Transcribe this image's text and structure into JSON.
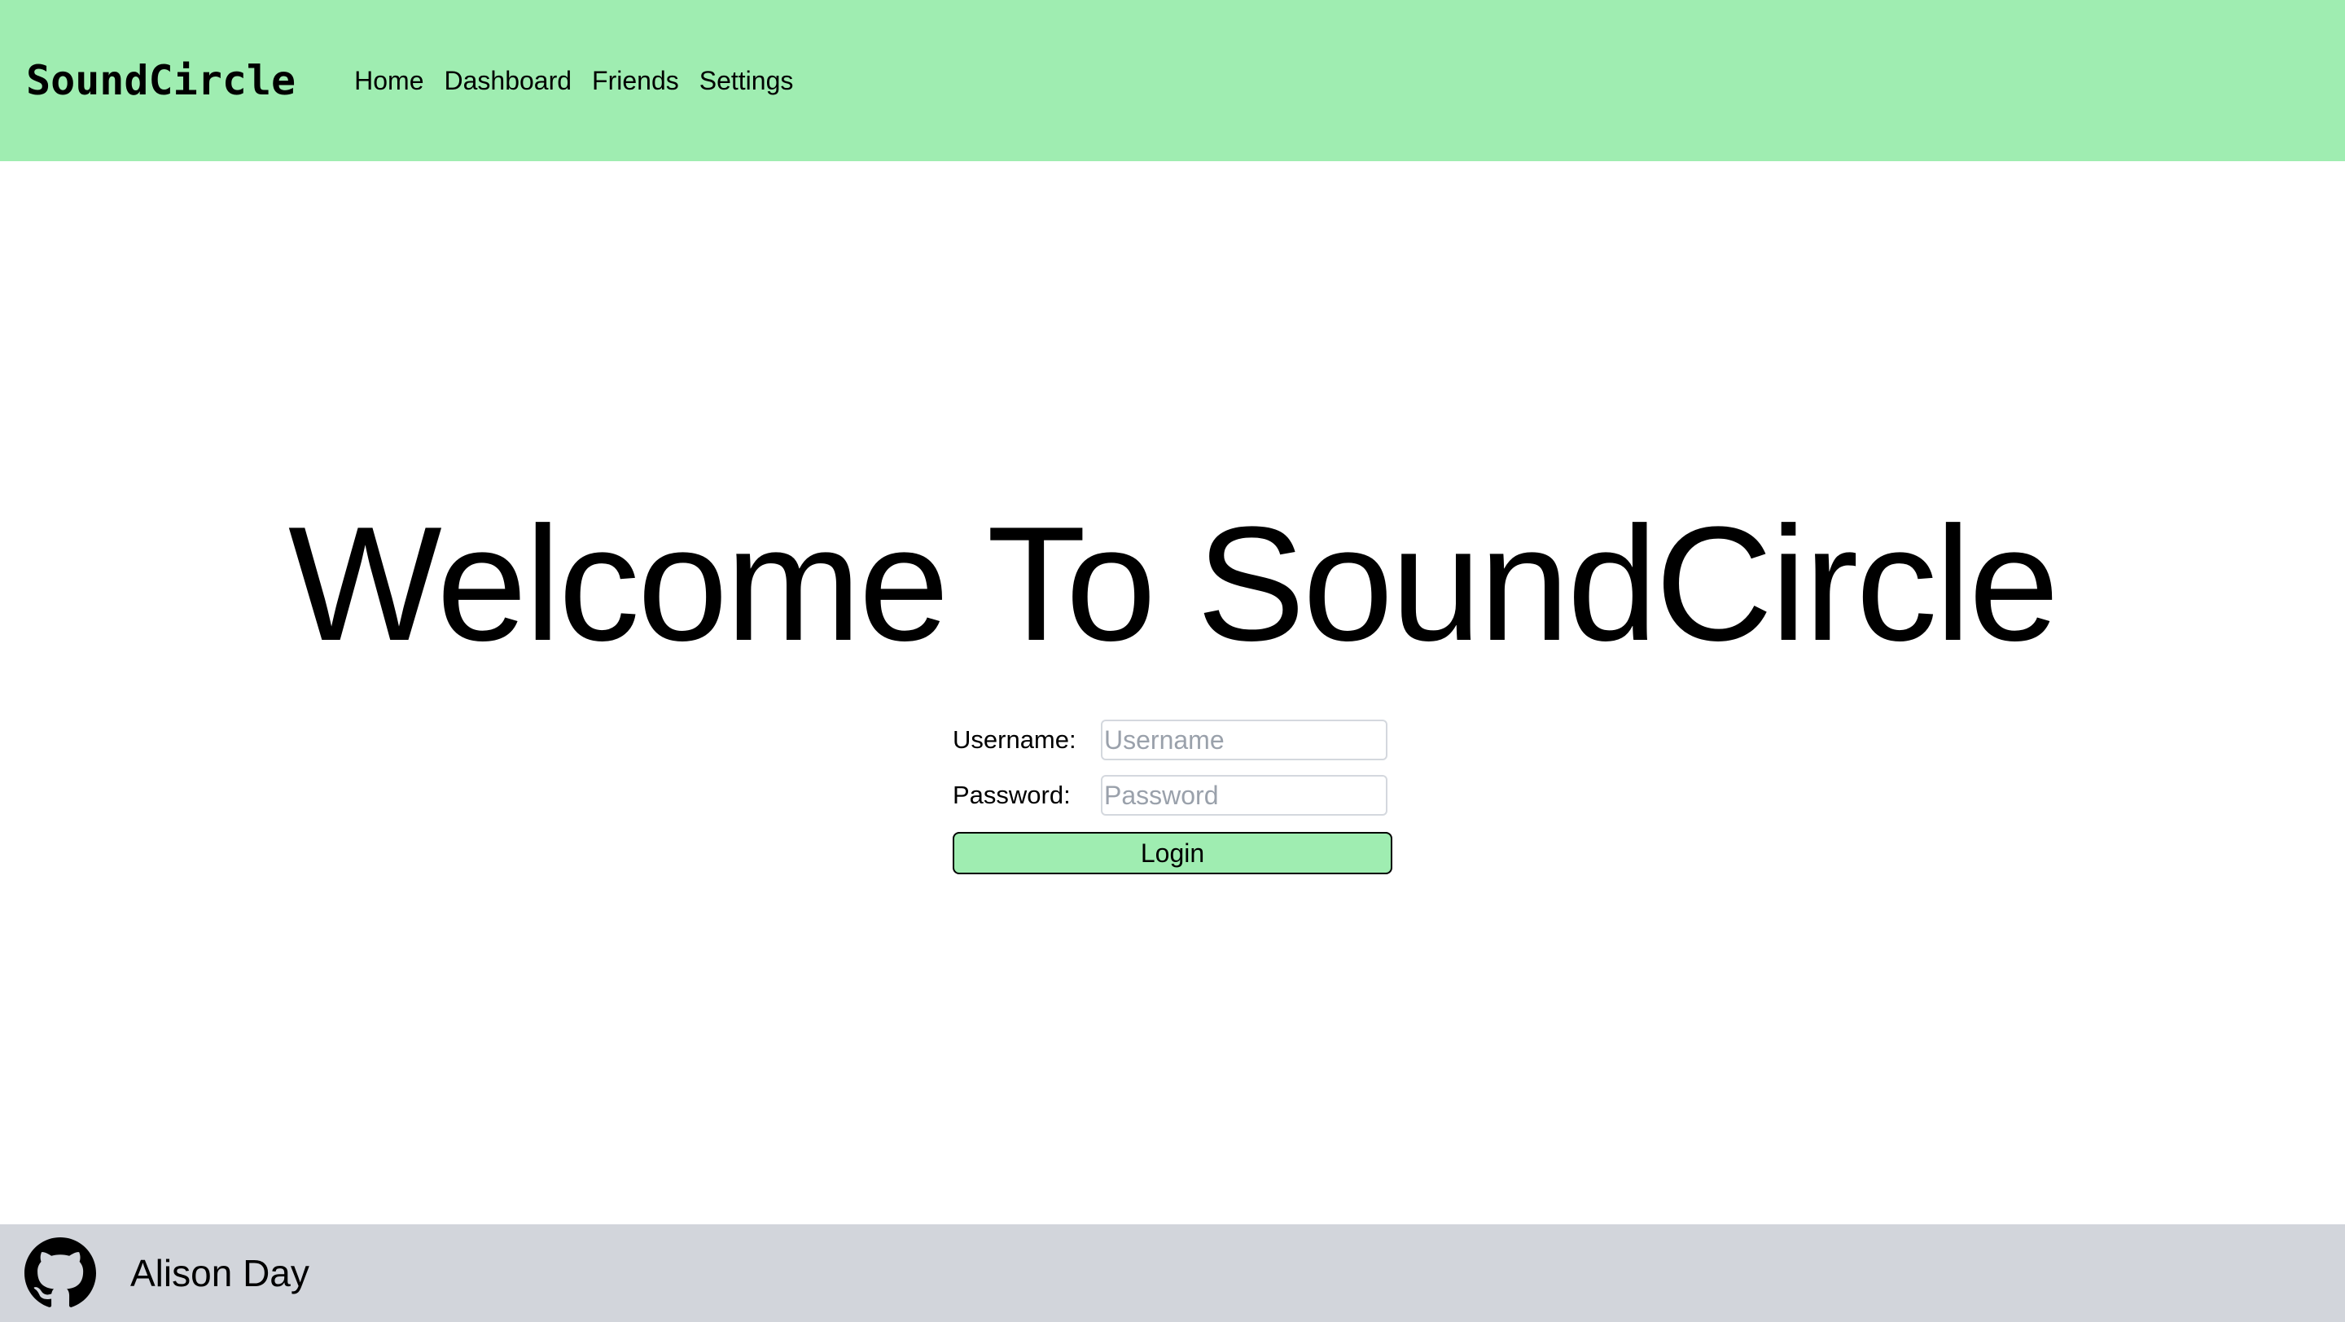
{
  "header": {
    "brand": "SoundCircle",
    "nav": [
      {
        "label": "Home"
      },
      {
        "label": "Dashboard"
      },
      {
        "label": "Friends"
      },
      {
        "label": "Settings"
      }
    ],
    "background_color": "#9fedb1"
  },
  "main": {
    "title": "Welcome To SoundCircle",
    "form": {
      "username_label": "Username:",
      "username_placeholder": "Username",
      "username_value": "",
      "password_label": "Password:",
      "password_placeholder": "Password",
      "password_value": "",
      "login_label": "Login",
      "button_color": "#9fedb1"
    }
  },
  "footer": {
    "icon": "github-icon",
    "name": "Alison Day",
    "background_color": "#d2d5db"
  }
}
